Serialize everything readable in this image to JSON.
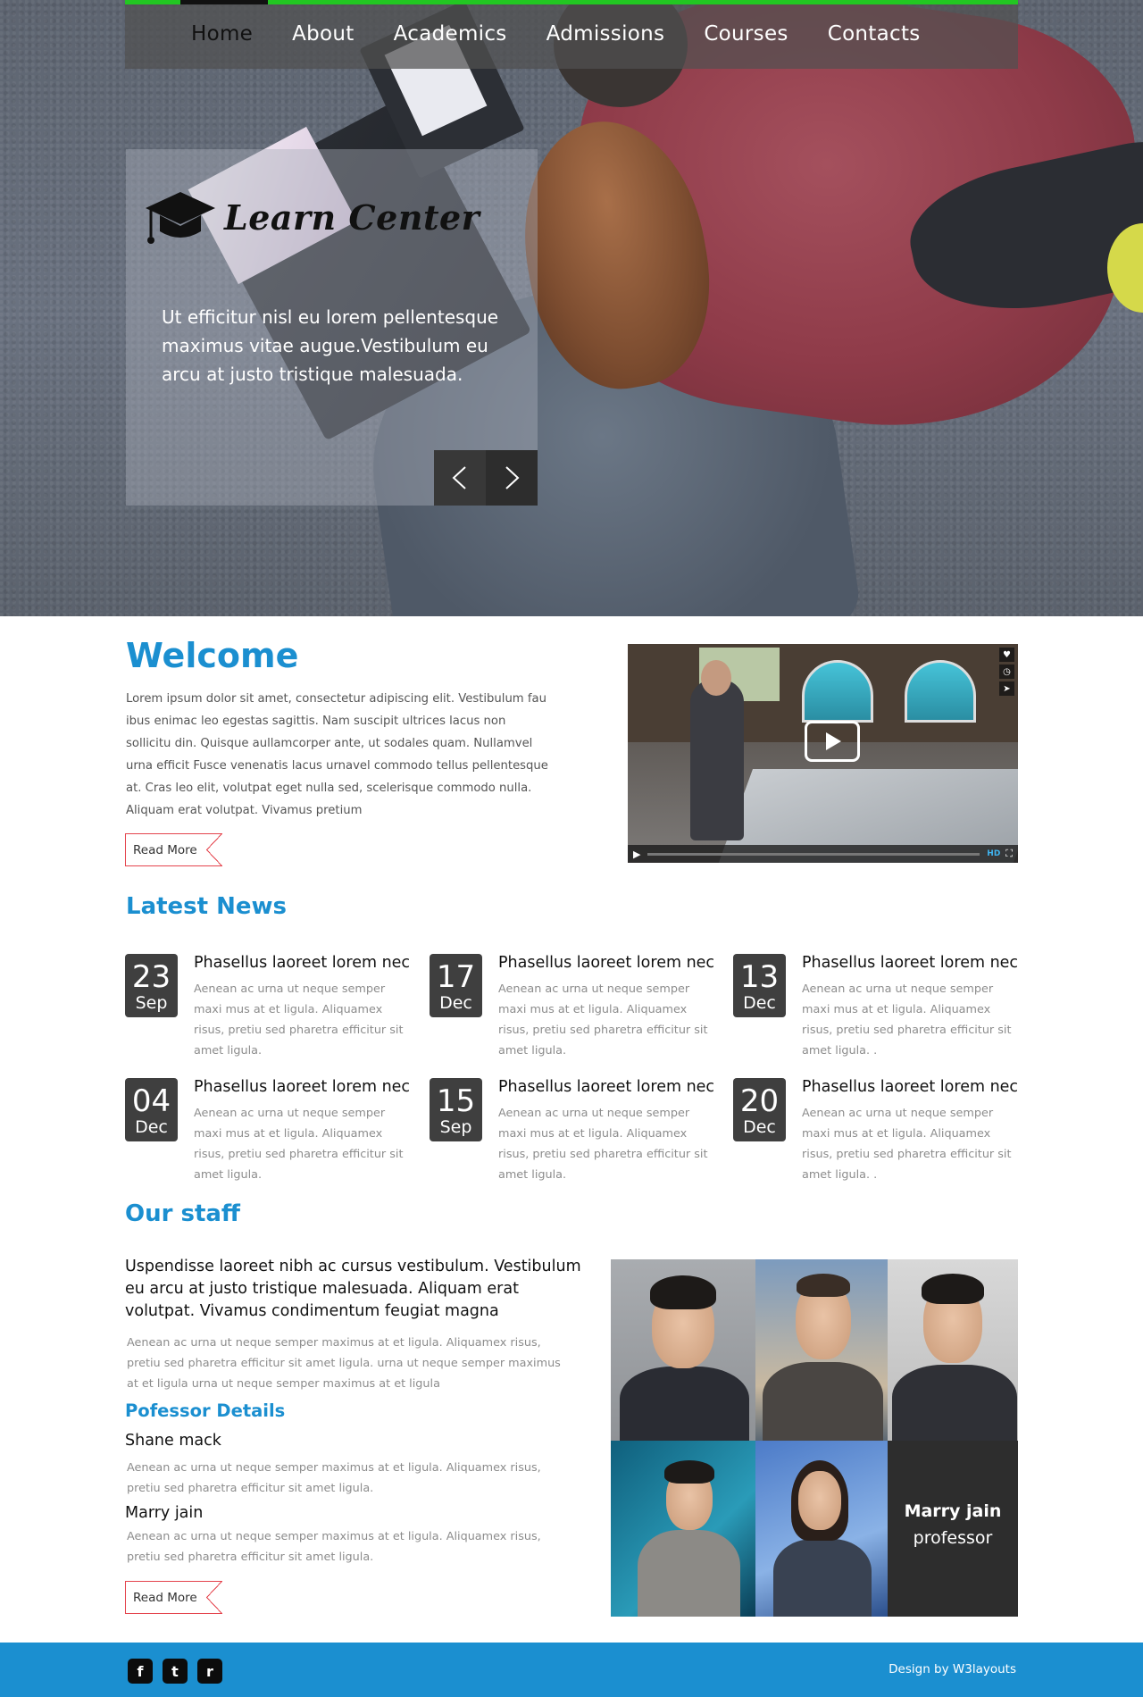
{
  "nav": {
    "items": [
      "Home",
      "About",
      "Academics",
      "Admissions",
      "Courses",
      "Contacts"
    ],
    "active": "Home"
  },
  "hero": {
    "logo_text": "Learn Center",
    "caption": "Ut efficitur nisl eu lorem pellentesque maximus vitae augue.Vestibulum eu arcu at justo tristique malesuada.",
    "prev_icon": "chevron-left-icon",
    "next_icon": "chevron-right-icon"
  },
  "welcome": {
    "title": "Welcome",
    "text": "Lorem ipsum dolor sit amet, consectetur adipiscing elit. Vestibulum fau ibus enimac leo egestas sagittis. Nam suscipit ultrices lacus non sollicitu din. Quisque aullamcorper ante, ut sodales quam. Nullamvel urna efficit Fusce venenatis lacus urnavel commodo tellus pellentesque at. Cras leo elit, volutpat eget nulla sed, scelerisque commodo nulla. Aliquam erat volutpat. Vivamus pretium",
    "read_more": "Read More"
  },
  "video": {
    "play_icon": "play-icon",
    "hd_label": "HD"
  },
  "news": {
    "title": "Latest News",
    "items": [
      {
        "day": "23",
        "month": "Sep",
        "headline": "Phasellus laoreet lorem nec",
        "body": "Aenean ac urna ut neque semper maxi mus at et ligula. Aliquamex risus, pretiu sed pharetra efficitur sit amet ligula."
      },
      {
        "day": "17",
        "month": "Dec",
        "headline": "Phasellus laoreet lorem nec",
        "body": "Aenean ac urna ut neque semper maxi mus at et ligula. Aliquamex risus, pretiu sed pharetra efficitur sit amet ligula."
      },
      {
        "day": "13",
        "month": "Dec",
        "headline": "Phasellus laoreet lorem nec",
        "body": "Aenean ac urna ut neque semper maxi mus at et ligula. Aliquamex risus, pretiu sed pharetra efficitur sit amet ligula. ."
      },
      {
        "day": "04",
        "month": "Dec",
        "headline": "Phasellus laoreet lorem nec",
        "body": "Aenean ac urna ut neque semper maxi mus at et ligula. Aliquamex risus, pretiu sed pharetra efficitur sit amet ligula."
      },
      {
        "day": "15",
        "month": "Sep",
        "headline": "Phasellus laoreet lorem nec",
        "body": "Aenean ac urna ut neque semper maxi mus at et ligula. Aliquamex risus, pretiu sed pharetra efficitur sit amet ligula."
      },
      {
        "day": "20",
        "month": "Dec",
        "headline": "Phasellus laoreet lorem nec",
        "body": "Aenean ac urna ut neque semper maxi mus at et ligula. Aliquamex risus, pretiu sed pharetra efficitur sit amet ligula. ."
      }
    ]
  },
  "staff": {
    "title": "Our staff",
    "lead": "Uspendisse laoreet nibh ac cursus vestibulum. Vestibulum eu arcu at justo tristique malesuada. Aliquam erat volutpat. Vivamus condimentum feugiat magna",
    "intro": "Aenean ac urna ut neque semper maximus at et ligula. Aliquamex risus, pretiu sed pharetra efficitur sit amet ligula. urna ut neque semper maximus at et ligula urna ut neque semper maximus at et ligula",
    "details_title": "Pofessor Details",
    "people": [
      {
        "name": "Shane mack",
        "bio": "Aenean ac urna ut neque semper maximus at et ligula. Aliquamex risus, pretiu sed pharetra efficitur sit amet ligula."
      },
      {
        "name": "Marry jain",
        "bio": "Aenean ac urna ut neque semper maximus at et ligula. Aliquamex risus, pretiu sed pharetra efficitur sit amet ligula."
      }
    ],
    "read_more": "Read More",
    "overlay": {
      "name": "Marry jain",
      "role": "professor"
    }
  },
  "footer": {
    "social": [
      {
        "icon": "facebook-icon",
        "glyph": "f"
      },
      {
        "icon": "twitter-icon",
        "glyph": "t"
      },
      {
        "icon": "rss-icon",
        "glyph": "r"
      }
    ],
    "credit": "Design by W3layouts"
  },
  "colors": {
    "accent": "#1b8fd0",
    "nav_top_bar": "#22c722",
    "date_box": "#3f3f3f",
    "read_more_border": "#e4444d"
  }
}
